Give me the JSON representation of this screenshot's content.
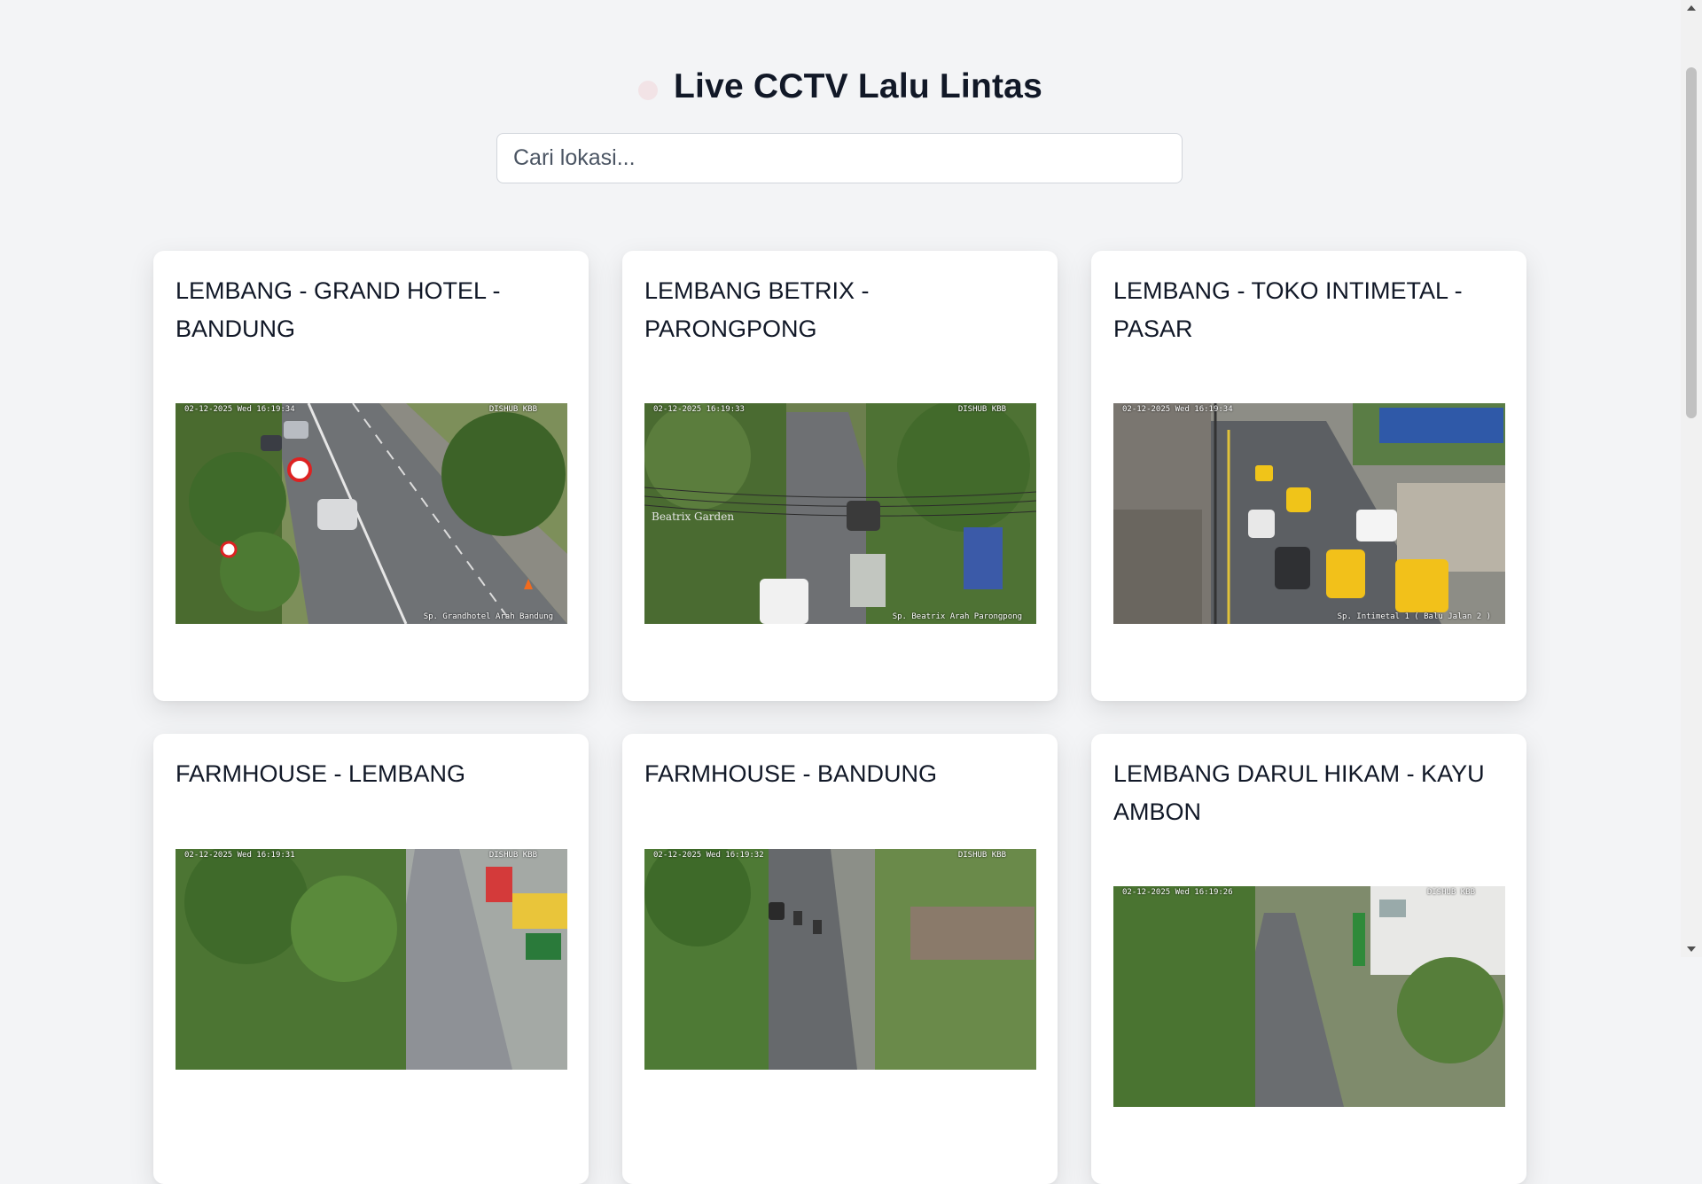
{
  "header": {
    "title": "Live CCTV Lalu Lintas",
    "live_indicator_icon": "live-dot-icon"
  },
  "search": {
    "placeholder": "Cari lokasi..."
  },
  "cameras": [
    {
      "name": "LEMBANG - GRAND HOTEL - BANDUNG",
      "osd_time": "02-12-2025 Wed 16:19:34",
      "osd_brand": "DISHUB KBB",
      "osd_location": "Sp. Grandhotel Arah Bandung"
    },
    {
      "name": "LEMBANG BETRIX - PARONGPONG",
      "osd_time": "02-12-2025 16:19:33",
      "osd_brand": "DISHUB KBB",
      "osd_location": "Sp. Beatrix Arah Parongpong"
    },
    {
      "name": "LEMBANG - TOKO INTIMETAL - PASAR",
      "osd_time": "02-12-2025 Wed 16:19:34",
      "osd_brand": "",
      "osd_location": "Sp. Intimetal 1 ( Balu Jalan 2 )"
    },
    {
      "name": "FARMHOUSE - LEMBANG",
      "osd_time": "02-12-2025 Wed 16:19:31",
      "osd_brand": "DISHUB KBB",
      "osd_location": ""
    },
    {
      "name": "FARMHOUSE - BANDUNG",
      "osd_time": "02-12-2025 Wed 16:19:32",
      "osd_brand": "DISHUB KBB",
      "osd_location": ""
    },
    {
      "name": "LEMBANG DARUL HIKAM - KAYU AMBON",
      "osd_time": "02-12-2025 Wed 16:19:26",
      "osd_brand": "DISHUB KBB",
      "osd_location": ""
    }
  ]
}
